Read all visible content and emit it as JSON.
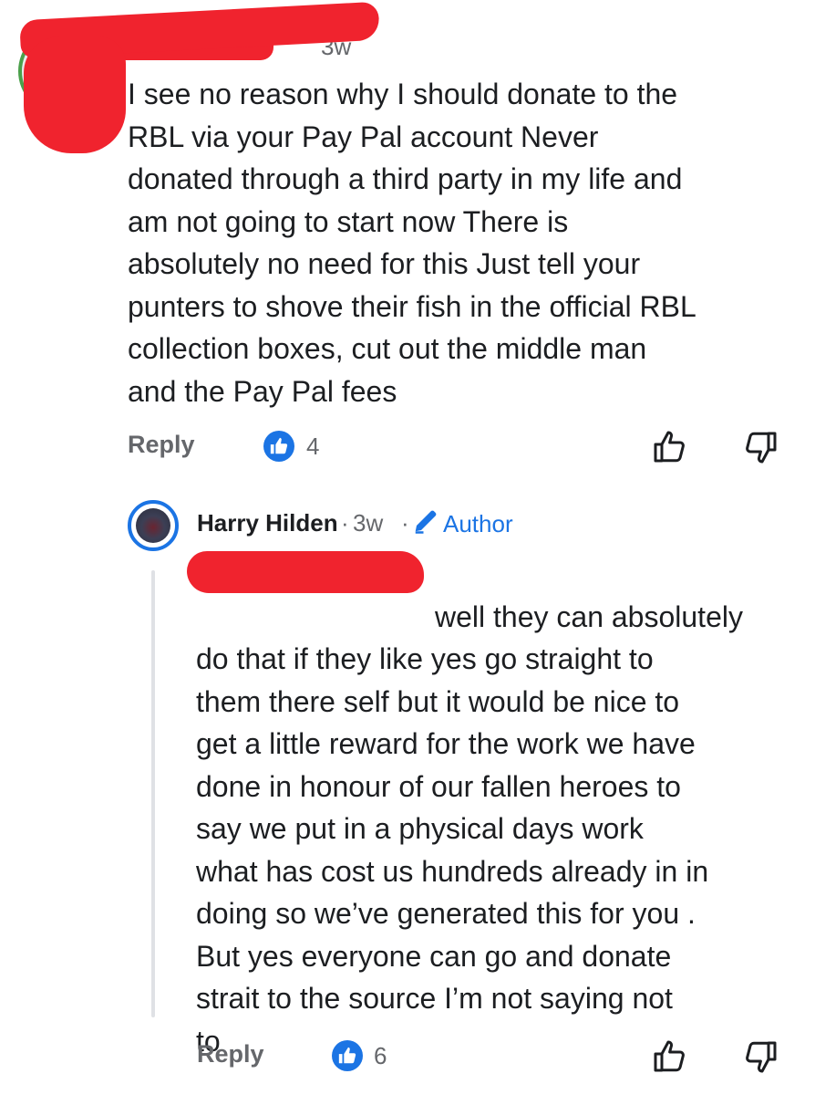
{
  "top_comment": {
    "timestamp": "3w",
    "text": "I see no reason why I should donate to the\nRBL via your Pay Pal  account Never\ndonated through a third party in my life and\nam not going to start now There is\nabsolutely no need for this Just tell your\npunters to shove their fish in the official RBL\ncollection boxes, cut out the middle man\nand the Pay Pal fees",
    "actions": {
      "reply_label": "Reply",
      "like_count": "4",
      "like_icon": "thumbs-up-icon",
      "dislike_icon": "thumbs-down-icon"
    }
  },
  "reply_comment": {
    "author": "Harry Hilden",
    "separator": "·",
    "timestamp": "3w",
    "author_badge": "Author",
    "author_badge_icon": "pencil-icon",
    "text": "well they can absolutely\ndo that if they like yes go straight to\nthem there self but it would be nice to\nget a little reward for the work we have\ndone in honour of our fallen heroes to\nsay we put in a physical days work\nwhat has cost us hundreds already in in\ndoing so we’ve generated this for you .\nBut yes everyone can go and donate\nstrait to the source I’m not saying not\nto",
    "actions": {
      "reply_label": "Reply",
      "like_count": "6",
      "like_icon": "thumbs-up-icon",
      "dislike_icon": "thumbs-down-icon"
    }
  },
  "colors": {
    "accent": "#1b74e4",
    "redaction": "#f0232e",
    "muted_text": "#65676b",
    "thread_line": "#dfe1e5"
  }
}
